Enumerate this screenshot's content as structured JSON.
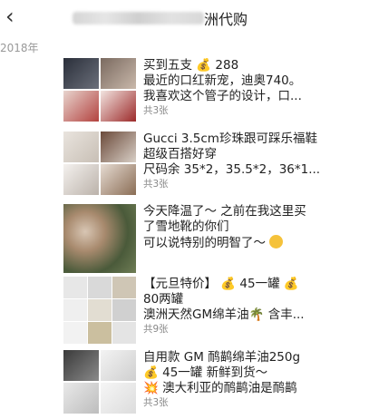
{
  "header": {
    "title_suffix": "洲代购",
    "back_icon": "chevron-left-icon"
  },
  "year": "2018年",
  "posts": [
    {
      "lines": [
        "买到五支 💰 288",
        "最近的口红新宠，迪奥740。",
        "我喜欢这个管子的设计，口..."
      ],
      "count": "共3张"
    },
    {
      "lines": [
        "Gucci 3.5cm珍珠跟可踩乐福鞋",
        "超级百搭好穿",
        "尺码余 35*2，35.5*2，36*1..."
      ],
      "count": "共3张"
    },
    {
      "lines": [
        "今天降温了～ 之前在我这里买",
        "了雪地靴的你们",
        "可以说特别的明智了～"
      ],
      "count": ""
    },
    {
      "lines": [
        "【元旦特价】 💰 45一罐 💰",
        "80两罐",
        "澳洲天然GM绵羊油🌴 含丰..."
      ],
      "count": "共9张"
    },
    {
      "lines": [
        "自用款 GM 鸸鹋绵羊油250g",
        "💰 45一罐 新鲜到货～",
        "💥 澳大利亚的鸸鹋油是鸸鹋"
      ],
      "count": "共3张"
    }
  ]
}
